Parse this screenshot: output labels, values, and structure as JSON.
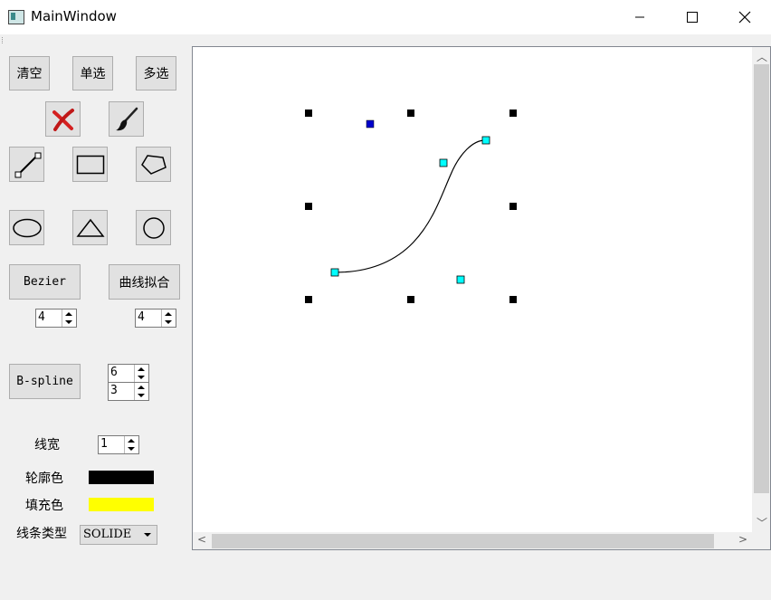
{
  "window": {
    "title": "MainWindow",
    "minimize_icon": "minimize-icon",
    "maximize_icon": "maximize-icon",
    "close_icon": "close-icon"
  },
  "toolbar": {
    "clear_label": "清空",
    "single_select_label": "单选",
    "multi_select_label": "多选",
    "delete_icon": "red-x-icon",
    "brush_icon": "paintbrush-icon",
    "line_icon": "line-tool-icon",
    "rect_icon": "rectangle-tool-icon",
    "polygon_icon": "polygon-tool-icon",
    "ellipse_icon": "ellipse-tool-icon",
    "triangle_icon": "triangle-tool-icon",
    "circle_icon": "circle-tool-icon",
    "bezier_label": "Bezier",
    "curve_fit_label": "曲线拟合",
    "bezier_spin": "4",
    "curve_fit_spin": "4",
    "bspline_label": "B-spline",
    "bspline_spin_a": "6",
    "bspline_spin_b": "3"
  },
  "properties": {
    "line_width_label": "线宽",
    "line_width_value": "1",
    "outline_color_label": "轮廓色",
    "outline_color": "#000000",
    "fill_color_label": "填充色",
    "fill_color": "#ffff00",
    "line_type_label": "线条类型",
    "line_type_value": "SOLIDE"
  },
  "canvas": {
    "control_point_color": "#00ffff",
    "selected_point_color": "#0000cc",
    "handle_color": "#000000"
  }
}
